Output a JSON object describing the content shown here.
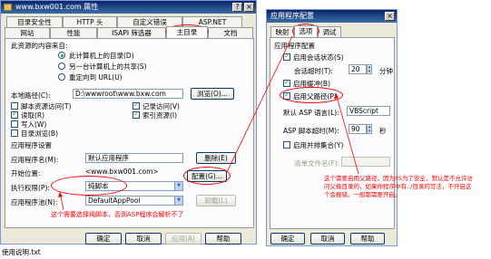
{
  "left_dialog": {
    "title": "www.bxw001.com 属性",
    "tabs_row1": [
      "目录安全性",
      "HTTP 头",
      "自定义错误",
      "ASP.NET"
    ],
    "tabs_row2": [
      "网站",
      "性能",
      "ISAPI 筛选器",
      "主目录",
      "文档"
    ],
    "active_tab": "主目录",
    "source_heading": "此资源的内容来自:",
    "source_options": [
      "此计算机上的目录(D)",
      "另一台计算机上的共享(S)",
      "重定向到 URL(U)"
    ],
    "local_path_label": "本地路径(C):",
    "local_path_value": "D:\\wwwroot\\www.bxw.com",
    "browse_button": "浏览(O)...",
    "perm_left": [
      {
        "label": "脚本资源访问(T)",
        "checked": false
      },
      {
        "label": "读取(R)",
        "checked": true
      },
      {
        "label": "写入(W)",
        "checked": false
      },
      {
        "label": "目录浏览(B)",
        "checked": false
      }
    ],
    "perm_right": [
      {
        "label": "记录访问(V)",
        "checked": true
      },
      {
        "label": "索引资源(I)",
        "checked": true
      }
    ],
    "app_settings_title": "应用程序设置",
    "app_name_label": "应用程序名(M):",
    "app_name_value": "默认应用程序",
    "remove_button": "删除(E)",
    "start_point_label": "开始位置:",
    "start_point_value": "<www.bxw001.com>",
    "exec_perm_label": "执行权限(P):",
    "exec_perm_value": "纯脚本",
    "config_button": "配置(G)...",
    "app_pool_label": "应用程序池(N):",
    "app_pool_value": "DefaultAppPool",
    "unload_button": "卸载(L)",
    "footer_buttons": [
      "确定",
      "取消",
      "应用(A)",
      "帮助"
    ]
  },
  "right_dialog": {
    "title": "应用程序配置",
    "tabs": [
      "映射",
      "选项",
      "调试"
    ],
    "active_tab": "选项",
    "group_title": "应用程序配置",
    "session_state_label": "启用会话状态(S)",
    "session_timeout_label": "会话超时(T):",
    "session_timeout_value": "20",
    "session_timeout_unit": "分钟",
    "buffering_label": "启用缓冲(B)",
    "parent_paths_label": "启用父路径(P)",
    "default_lang_label": "默认 ASP 语言(L):",
    "default_lang_value": "VBScript",
    "script_timeout_label": "ASP 脚本超时(M):",
    "script_timeout_value": "90",
    "script_timeout_unit": "秒",
    "side_by_side_label": "启用并排集合(Y)",
    "manifest_label": "清单文件名(F):",
    "footer_buttons": [
      "确定",
      "取消",
      "帮助"
    ]
  },
  "annotations": {
    "note_left": "这个需要选择纯脚本，否则ASP程序会解析不了",
    "note_right": [
      "这个需要启用父路径，因为IIS为了安全，默认是不允许访",
      "问父级目录的，如果你程序中有../目录的写法，不开启这",
      "个会报错。一般都需要开启。"
    ]
  },
  "background_text": "使用说明.txt",
  "colors": {
    "annotation_red": "#ff0000",
    "title_bar": "#0a246a",
    "dialog_bg": "#ece9d8"
  }
}
